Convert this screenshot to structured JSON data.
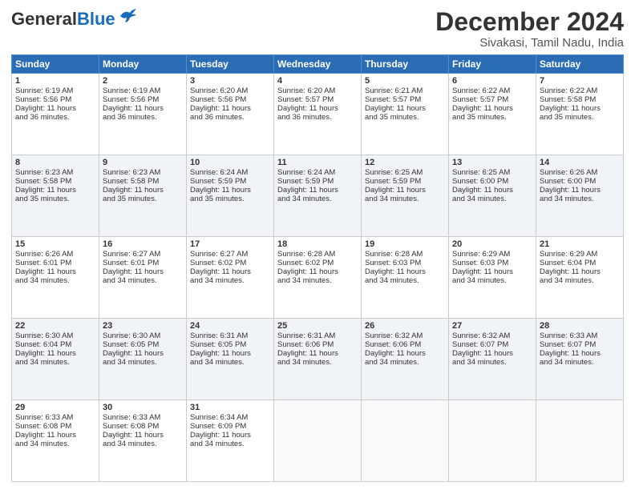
{
  "header": {
    "logo_general": "General",
    "logo_blue": "Blue",
    "title": "December 2024",
    "subtitle": "Sivakasi, Tamil Nadu, India"
  },
  "weekdays": [
    "Sunday",
    "Monday",
    "Tuesday",
    "Wednesday",
    "Thursday",
    "Friday",
    "Saturday"
  ],
  "weeks": [
    [
      {
        "day": "1",
        "lines": [
          "Sunrise: 6:19 AM",
          "Sunset: 5:56 PM",
          "Daylight: 11 hours",
          "and 36 minutes."
        ]
      },
      {
        "day": "2",
        "lines": [
          "Sunrise: 6:19 AM",
          "Sunset: 5:56 PM",
          "Daylight: 11 hours",
          "and 36 minutes."
        ]
      },
      {
        "day": "3",
        "lines": [
          "Sunrise: 6:20 AM",
          "Sunset: 5:56 PM",
          "Daylight: 11 hours",
          "and 36 minutes."
        ]
      },
      {
        "day": "4",
        "lines": [
          "Sunrise: 6:20 AM",
          "Sunset: 5:57 PM",
          "Daylight: 11 hours",
          "and 36 minutes."
        ]
      },
      {
        "day": "5",
        "lines": [
          "Sunrise: 6:21 AM",
          "Sunset: 5:57 PM",
          "Daylight: 11 hours",
          "and 35 minutes."
        ]
      },
      {
        "day": "6",
        "lines": [
          "Sunrise: 6:22 AM",
          "Sunset: 5:57 PM",
          "Daylight: 11 hours",
          "and 35 minutes."
        ]
      },
      {
        "day": "7",
        "lines": [
          "Sunrise: 6:22 AM",
          "Sunset: 5:58 PM",
          "Daylight: 11 hours",
          "and 35 minutes."
        ]
      }
    ],
    [
      {
        "day": "8",
        "lines": [
          "Sunrise: 6:23 AM",
          "Sunset: 5:58 PM",
          "Daylight: 11 hours",
          "and 35 minutes."
        ]
      },
      {
        "day": "9",
        "lines": [
          "Sunrise: 6:23 AM",
          "Sunset: 5:58 PM",
          "Daylight: 11 hours",
          "and 35 minutes."
        ]
      },
      {
        "day": "10",
        "lines": [
          "Sunrise: 6:24 AM",
          "Sunset: 5:59 PM",
          "Daylight: 11 hours",
          "and 35 minutes."
        ]
      },
      {
        "day": "11",
        "lines": [
          "Sunrise: 6:24 AM",
          "Sunset: 5:59 PM",
          "Daylight: 11 hours",
          "and 34 minutes."
        ]
      },
      {
        "day": "12",
        "lines": [
          "Sunrise: 6:25 AM",
          "Sunset: 5:59 PM",
          "Daylight: 11 hours",
          "and 34 minutes."
        ]
      },
      {
        "day": "13",
        "lines": [
          "Sunrise: 6:25 AM",
          "Sunset: 6:00 PM",
          "Daylight: 11 hours",
          "and 34 minutes."
        ]
      },
      {
        "day": "14",
        "lines": [
          "Sunrise: 6:26 AM",
          "Sunset: 6:00 PM",
          "Daylight: 11 hours",
          "and 34 minutes."
        ]
      }
    ],
    [
      {
        "day": "15",
        "lines": [
          "Sunrise: 6:26 AM",
          "Sunset: 6:01 PM",
          "Daylight: 11 hours",
          "and 34 minutes."
        ]
      },
      {
        "day": "16",
        "lines": [
          "Sunrise: 6:27 AM",
          "Sunset: 6:01 PM",
          "Daylight: 11 hours",
          "and 34 minutes."
        ]
      },
      {
        "day": "17",
        "lines": [
          "Sunrise: 6:27 AM",
          "Sunset: 6:02 PM",
          "Daylight: 11 hours",
          "and 34 minutes."
        ]
      },
      {
        "day": "18",
        "lines": [
          "Sunrise: 6:28 AM",
          "Sunset: 6:02 PM",
          "Daylight: 11 hours",
          "and 34 minutes."
        ]
      },
      {
        "day": "19",
        "lines": [
          "Sunrise: 6:28 AM",
          "Sunset: 6:03 PM",
          "Daylight: 11 hours",
          "and 34 minutes."
        ]
      },
      {
        "day": "20",
        "lines": [
          "Sunrise: 6:29 AM",
          "Sunset: 6:03 PM",
          "Daylight: 11 hours",
          "and 34 minutes."
        ]
      },
      {
        "day": "21",
        "lines": [
          "Sunrise: 6:29 AM",
          "Sunset: 6:04 PM",
          "Daylight: 11 hours",
          "and 34 minutes."
        ]
      }
    ],
    [
      {
        "day": "22",
        "lines": [
          "Sunrise: 6:30 AM",
          "Sunset: 6:04 PM",
          "Daylight: 11 hours",
          "and 34 minutes."
        ]
      },
      {
        "day": "23",
        "lines": [
          "Sunrise: 6:30 AM",
          "Sunset: 6:05 PM",
          "Daylight: 11 hours",
          "and 34 minutes."
        ]
      },
      {
        "day": "24",
        "lines": [
          "Sunrise: 6:31 AM",
          "Sunset: 6:05 PM",
          "Daylight: 11 hours",
          "and 34 minutes."
        ]
      },
      {
        "day": "25",
        "lines": [
          "Sunrise: 6:31 AM",
          "Sunset: 6:06 PM",
          "Daylight: 11 hours",
          "and 34 minutes."
        ]
      },
      {
        "day": "26",
        "lines": [
          "Sunrise: 6:32 AM",
          "Sunset: 6:06 PM",
          "Daylight: 11 hours",
          "and 34 minutes."
        ]
      },
      {
        "day": "27",
        "lines": [
          "Sunrise: 6:32 AM",
          "Sunset: 6:07 PM",
          "Daylight: 11 hours",
          "and 34 minutes."
        ]
      },
      {
        "day": "28",
        "lines": [
          "Sunrise: 6:33 AM",
          "Sunset: 6:07 PM",
          "Daylight: 11 hours",
          "and 34 minutes."
        ]
      }
    ],
    [
      {
        "day": "29",
        "lines": [
          "Sunrise: 6:33 AM",
          "Sunset: 6:08 PM",
          "Daylight: 11 hours",
          "and 34 minutes."
        ]
      },
      {
        "day": "30",
        "lines": [
          "Sunrise: 6:33 AM",
          "Sunset: 6:08 PM",
          "Daylight: 11 hours",
          "and 34 minutes."
        ]
      },
      {
        "day": "31",
        "lines": [
          "Sunrise: 6:34 AM",
          "Sunset: 6:09 PM",
          "Daylight: 11 hours",
          "and 34 minutes."
        ]
      },
      null,
      null,
      null,
      null
    ]
  ]
}
